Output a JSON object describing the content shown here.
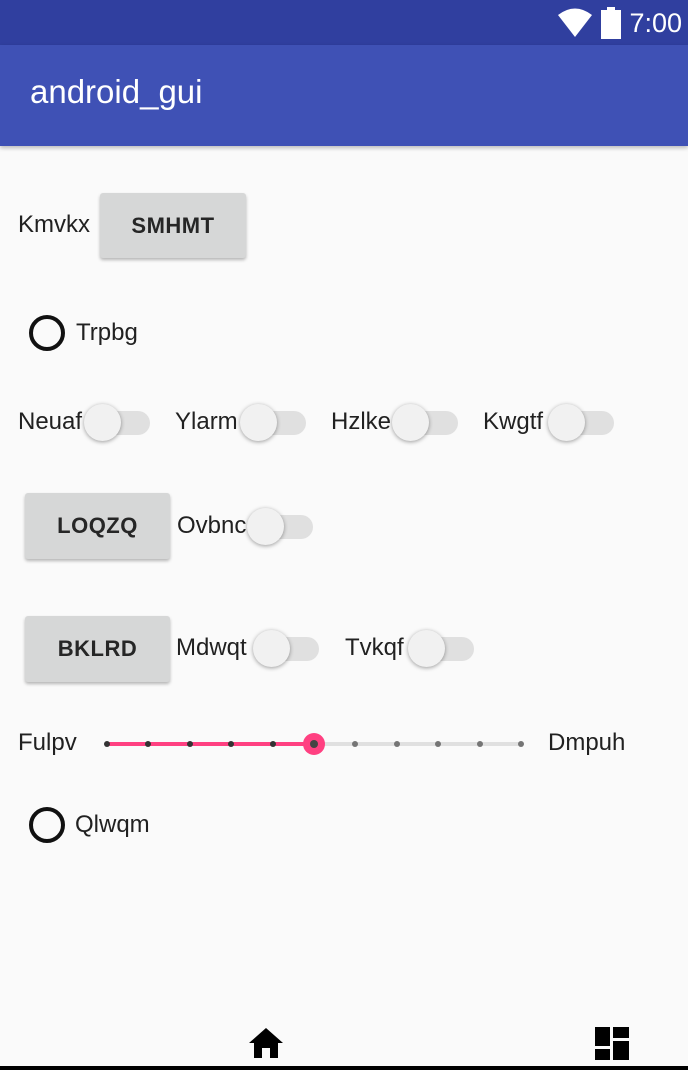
{
  "status_bar": {
    "time": "7:00",
    "wifi_icon": "wifi-icon",
    "battery_icon": "battery-icon"
  },
  "app_bar": {
    "title": "android_gui"
  },
  "row1": {
    "label": "Kmvkx",
    "button": "SMHMT"
  },
  "radio1": {
    "label": "Trpbg",
    "checked": false
  },
  "switch_row": [
    {
      "label": "Neuaf",
      "on": false
    },
    {
      "label": "Ylarm",
      "on": false
    },
    {
      "label": "Hzlke",
      "on": false
    },
    {
      "label": "Kwgtf",
      "on": false
    }
  ],
  "row4": {
    "button": "LOQZQ",
    "switch_label": "Ovbnc",
    "on": false
  },
  "row5": {
    "button": "BKLRD",
    "switch1_label": "Mdwqt",
    "switch2_label": "Tvkqf"
  },
  "slider": {
    "left_label": "Fulpv",
    "right_label": "Dmpuh",
    "steps": 10,
    "value": 5,
    "accent": "#ff4081",
    "track": "#e0e0e0",
    "tick": "#757575"
  },
  "radio2": {
    "label": "Qlwqm",
    "checked": false
  },
  "bottom_nav": {
    "home_icon": "home-icon",
    "dashboard_icon": "dashboard-icon"
  },
  "colors": {
    "status_bar": "#303f9f",
    "app_bar": "#3f51b5",
    "background": "#fafafa",
    "button": "#d6d7d7"
  }
}
